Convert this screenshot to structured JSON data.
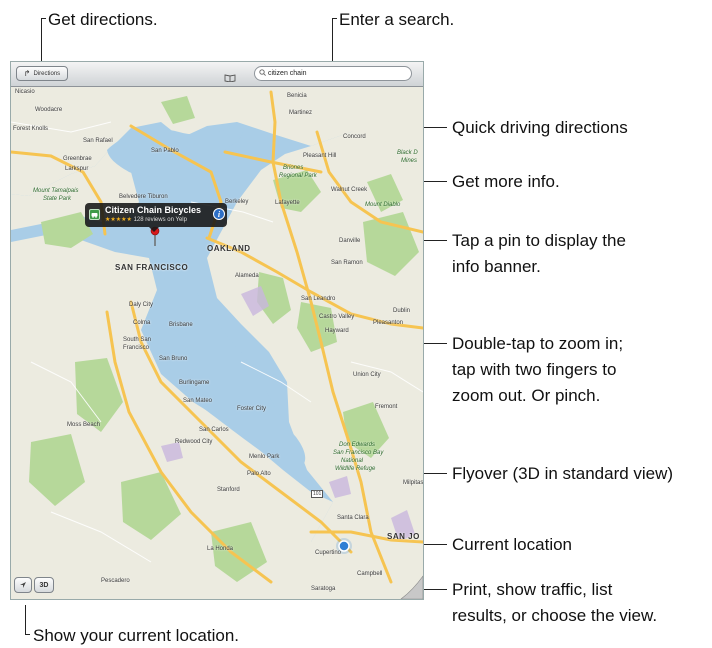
{
  "callouts": {
    "get_directions": "Get directions.",
    "enter_search": "Enter a search.",
    "quick_driving": "Quick driving directions",
    "more_info": "Get more info.",
    "tap_pin_1": "Tap a pin to display the",
    "tap_pin_2": "info banner.",
    "double_tap_1": "Double-tap to zoom in;",
    "double_tap_2": "tap with two fingers to",
    "double_tap_3": "zoom out. Or pinch.",
    "flyover": "Flyover (3D in standard view)",
    "current_location": "Current location",
    "print_1": "Print, show traffic, list",
    "print_2": "results, or choose the view.",
    "show_location": "Show your current location."
  },
  "toolbar": {
    "directions_label": "Directions",
    "search_value": "citizen chain"
  },
  "banner": {
    "title": "Citizen Chain Bicycles",
    "stars": "★★★★★",
    "reviews": "128 reviews on Yelp"
  },
  "bottom": {
    "threed_label": "3D"
  },
  "places": {
    "nicasio": "Nicasio",
    "woodacre": "Woodacre",
    "forest_knolls": "Forest Knolls",
    "san_rafael": "San Rafael",
    "greenbrae": "Greenbrae",
    "larkspur": "Larkspur",
    "mount_tamalpais": "Mount Tamalpais",
    "state_park": "State Park",
    "belvedere": "Belvedere Tiburon",
    "san_pablo": "San Pablo",
    "benicia": "Benicia",
    "martinez": "Martinez",
    "concord": "Concord",
    "pleasant_hill": "Pleasant Hill",
    "briones": "Briones",
    "regional_park": "Regional Park",
    "black_diamond": "Black D",
    "mines": "Mines",
    "walnut_creek": "Walnut Creek",
    "lafayette": "Lafayette",
    "berkeley": "Berkeley",
    "mount_diablo": "Mount Diablo",
    "oakland": "OAKLAND",
    "danville": "Danville",
    "san_francisco": "SAN FRANCISCO",
    "alameda": "Alameda",
    "san_ramon": "San Ramon",
    "daly_city": "Daly City",
    "colma": "Colma",
    "brisbane": "Brisbane",
    "south_sf_1": "South San",
    "south_sf_2": "Francisco",
    "san_bruno": "San Bruno",
    "san_leandro": "San Leandro",
    "castro_valley": "Castro Valley",
    "dublin": "Dublin",
    "pleasanton": "Pleasanton",
    "hayward": "Hayward",
    "union_city": "Union City",
    "burlingame": "Burlingame",
    "san_mateo": "San Mateo",
    "foster_city": "Foster City",
    "fremont": "Fremont",
    "moss_beach": "Moss Beach",
    "san_carlos": "San Carlos",
    "redwood_city": "Redwood City",
    "don_edwards_1": "Don Edwards",
    "don_edwards_2": "San Francisco Bay",
    "don_edwards_3": "National",
    "don_edwards_4": "Wildlife Refuge",
    "menlo_park": "Menlo Park",
    "palo_alto": "Palo Alto",
    "stanford": "Stanford",
    "milpitas": "Milpitas",
    "cupertino": "Cupertino",
    "san_jose": "SAN JO",
    "santa_clara": "Santa Clara",
    "campbell": "Campbell",
    "la_honda": "La Honda",
    "pescadero": "Pescadero",
    "saratoga": "Saratoga",
    "hwy_101": "101"
  },
  "colors": {
    "water": "#a9cde7",
    "land": "#ecebe0",
    "park": "#b6d89a",
    "freeway": "#f6c451",
    "pin": "#d7191c",
    "location_dot": "#2f7fd4",
    "info_button": "#2d6fc6"
  }
}
